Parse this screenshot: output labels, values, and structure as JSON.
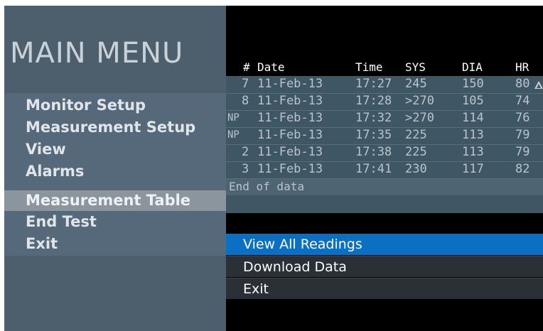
{
  "menu": {
    "title": "MAIN MENU",
    "items": [
      {
        "label": "Monitor Setup"
      },
      {
        "label": "Measurement Setup"
      },
      {
        "label": "View"
      },
      {
        "label": "Alarms"
      },
      {
        "label": "Measurement Table"
      },
      {
        "label": "End Test"
      },
      {
        "label": "Exit"
      }
    ],
    "selected": "Measurement Table"
  },
  "table": {
    "headers": [
      "#",
      "Date",
      "Time",
      "SYS",
      "DIA",
      "HR"
    ],
    "rows": [
      [
        "7",
        "11-Feb-13",
        "17:27",
        "245",
        "150",
        "80"
      ],
      [
        "8",
        "11-Feb-13",
        "17:28",
        ">270",
        "105",
        "74"
      ],
      [
        "NP",
        "11-Feb-13",
        "17:32",
        ">270",
        "114",
        "76"
      ],
      [
        "NP",
        "11-Feb-13",
        "17:35",
        "225",
        "113",
        "79"
      ],
      [
        "2",
        "11-Feb-13",
        "17:38",
        "225",
        "113",
        "79"
      ],
      [
        "3",
        "11-Feb-13",
        "17:41",
        "230",
        "117",
        "82"
      ]
    ],
    "end_label": "End of data"
  },
  "submenu": {
    "items": [
      {
        "label": "View All Readings"
      },
      {
        "label": "Download Data"
      },
      {
        "label": "Exit"
      }
    ],
    "active": "View All Readings"
  }
}
